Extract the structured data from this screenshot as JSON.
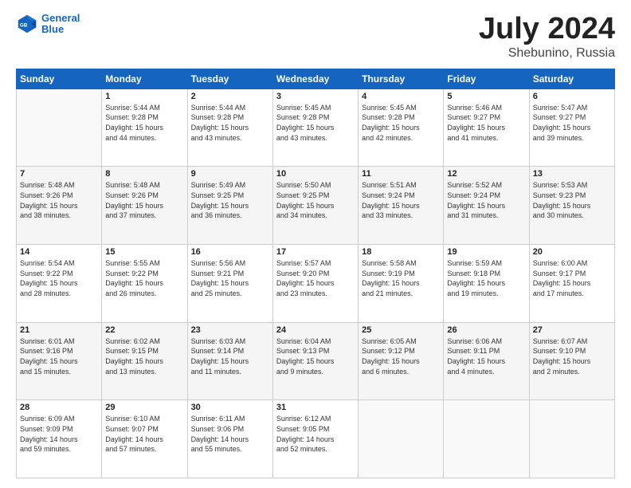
{
  "header": {
    "logo_line1": "General",
    "logo_line2": "Blue",
    "title": "July 2024",
    "subtitle": "Shebunino, Russia"
  },
  "calendar": {
    "days_of_week": [
      "Sunday",
      "Monday",
      "Tuesday",
      "Wednesday",
      "Thursday",
      "Friday",
      "Saturday"
    ],
    "weeks": [
      [
        {
          "day": "",
          "info": ""
        },
        {
          "day": "1",
          "info": "Sunrise: 5:44 AM\nSunset: 9:28 PM\nDaylight: 15 hours\nand 44 minutes."
        },
        {
          "day": "2",
          "info": "Sunrise: 5:44 AM\nSunset: 9:28 PM\nDaylight: 15 hours\nand 43 minutes."
        },
        {
          "day": "3",
          "info": "Sunrise: 5:45 AM\nSunset: 9:28 PM\nDaylight: 15 hours\nand 43 minutes."
        },
        {
          "day": "4",
          "info": "Sunrise: 5:45 AM\nSunset: 9:28 PM\nDaylight: 15 hours\nand 42 minutes."
        },
        {
          "day": "5",
          "info": "Sunrise: 5:46 AM\nSunset: 9:27 PM\nDaylight: 15 hours\nand 41 minutes."
        },
        {
          "day": "6",
          "info": "Sunrise: 5:47 AM\nSunset: 9:27 PM\nDaylight: 15 hours\nand 39 minutes."
        }
      ],
      [
        {
          "day": "7",
          "info": "Sunrise: 5:48 AM\nSunset: 9:26 PM\nDaylight: 15 hours\nand 38 minutes."
        },
        {
          "day": "8",
          "info": "Sunrise: 5:48 AM\nSunset: 9:26 PM\nDaylight: 15 hours\nand 37 minutes."
        },
        {
          "day": "9",
          "info": "Sunrise: 5:49 AM\nSunset: 9:25 PM\nDaylight: 15 hours\nand 36 minutes."
        },
        {
          "day": "10",
          "info": "Sunrise: 5:50 AM\nSunset: 9:25 PM\nDaylight: 15 hours\nand 34 minutes."
        },
        {
          "day": "11",
          "info": "Sunrise: 5:51 AM\nSunset: 9:24 PM\nDaylight: 15 hours\nand 33 minutes."
        },
        {
          "day": "12",
          "info": "Sunrise: 5:52 AM\nSunset: 9:24 PM\nDaylight: 15 hours\nand 31 minutes."
        },
        {
          "day": "13",
          "info": "Sunrise: 5:53 AM\nSunset: 9:23 PM\nDaylight: 15 hours\nand 30 minutes."
        }
      ],
      [
        {
          "day": "14",
          "info": "Sunrise: 5:54 AM\nSunset: 9:22 PM\nDaylight: 15 hours\nand 28 minutes."
        },
        {
          "day": "15",
          "info": "Sunrise: 5:55 AM\nSunset: 9:22 PM\nDaylight: 15 hours\nand 26 minutes."
        },
        {
          "day": "16",
          "info": "Sunrise: 5:56 AM\nSunset: 9:21 PM\nDaylight: 15 hours\nand 25 minutes."
        },
        {
          "day": "17",
          "info": "Sunrise: 5:57 AM\nSunset: 9:20 PM\nDaylight: 15 hours\nand 23 minutes."
        },
        {
          "day": "18",
          "info": "Sunrise: 5:58 AM\nSunset: 9:19 PM\nDaylight: 15 hours\nand 21 minutes."
        },
        {
          "day": "19",
          "info": "Sunrise: 5:59 AM\nSunset: 9:18 PM\nDaylight: 15 hours\nand 19 minutes."
        },
        {
          "day": "20",
          "info": "Sunrise: 6:00 AM\nSunset: 9:17 PM\nDaylight: 15 hours\nand 17 minutes."
        }
      ],
      [
        {
          "day": "21",
          "info": "Sunrise: 6:01 AM\nSunset: 9:16 PM\nDaylight: 15 hours\nand 15 minutes."
        },
        {
          "day": "22",
          "info": "Sunrise: 6:02 AM\nSunset: 9:15 PM\nDaylight: 15 hours\nand 13 minutes."
        },
        {
          "day": "23",
          "info": "Sunrise: 6:03 AM\nSunset: 9:14 PM\nDaylight: 15 hours\nand 11 minutes."
        },
        {
          "day": "24",
          "info": "Sunrise: 6:04 AM\nSunset: 9:13 PM\nDaylight: 15 hours\nand 9 minutes."
        },
        {
          "day": "25",
          "info": "Sunrise: 6:05 AM\nSunset: 9:12 PM\nDaylight: 15 hours\nand 6 minutes."
        },
        {
          "day": "26",
          "info": "Sunrise: 6:06 AM\nSunset: 9:11 PM\nDaylight: 15 hours\nand 4 minutes."
        },
        {
          "day": "27",
          "info": "Sunrise: 6:07 AM\nSunset: 9:10 PM\nDaylight: 15 hours\nand 2 minutes."
        }
      ],
      [
        {
          "day": "28",
          "info": "Sunrise: 6:09 AM\nSunset: 9:09 PM\nDaylight: 14 hours\nand 59 minutes."
        },
        {
          "day": "29",
          "info": "Sunrise: 6:10 AM\nSunset: 9:07 PM\nDaylight: 14 hours\nand 57 minutes."
        },
        {
          "day": "30",
          "info": "Sunrise: 6:11 AM\nSunset: 9:06 PM\nDaylight: 14 hours\nand 55 minutes."
        },
        {
          "day": "31",
          "info": "Sunrise: 6:12 AM\nSunset: 9:05 PM\nDaylight: 14 hours\nand 52 minutes."
        },
        {
          "day": "",
          "info": ""
        },
        {
          "day": "",
          "info": ""
        },
        {
          "day": "",
          "info": ""
        }
      ]
    ]
  }
}
